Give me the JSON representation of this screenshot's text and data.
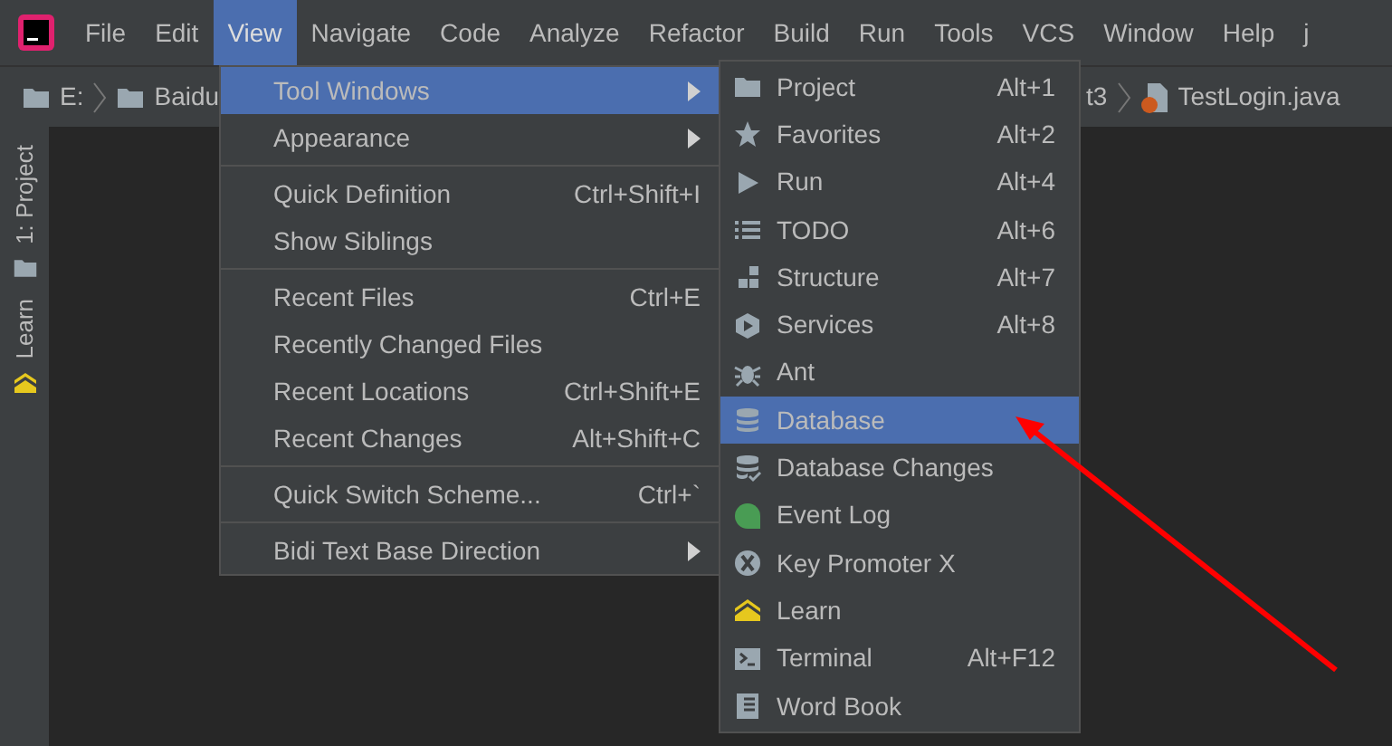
{
  "menu_bar": [
    {
      "label": "File",
      "selected": false
    },
    {
      "label": "Edit",
      "selected": false
    },
    {
      "label": "View",
      "selected": true
    },
    {
      "label": "Navigate",
      "selected": false
    },
    {
      "label": "Code",
      "selected": false
    },
    {
      "label": "Analyze",
      "selected": false
    },
    {
      "label": "Refactor",
      "selected": false
    },
    {
      "label": "Build",
      "selected": false
    },
    {
      "label": "Run",
      "selected": false
    },
    {
      "label": "Tools",
      "selected": false
    },
    {
      "label": "VCS",
      "selected": false
    },
    {
      "label": "Window",
      "selected": false
    },
    {
      "label": "Help",
      "selected": false
    },
    {
      "label": "j",
      "selected": false
    }
  ],
  "breadcrumbs": [
    {
      "label": "E:"
    },
    {
      "label": "Baidu"
    },
    {
      "label": "t3"
    },
    {
      "label": "TestLogin.java"
    }
  ],
  "tool_strip": [
    {
      "label": "1: Project"
    },
    {
      "label": "Learn"
    }
  ],
  "view_menu": [
    {
      "kind": "item",
      "label": "Tool Windows",
      "submenu": true,
      "selected": true
    },
    {
      "kind": "item",
      "label": "Appearance",
      "submenu": true,
      "selected": false
    },
    {
      "kind": "separator"
    },
    {
      "kind": "item",
      "label": "Quick Definition",
      "shortcut": "Ctrl+Shift+I",
      "submenu": false,
      "selected": false
    },
    {
      "kind": "item",
      "label": "Show Siblings",
      "submenu": false,
      "selected": false
    },
    {
      "kind": "separator"
    },
    {
      "kind": "item",
      "label": "Recent Files",
      "shortcut": "Ctrl+E",
      "submenu": false,
      "selected": false
    },
    {
      "kind": "item",
      "label": "Recently Changed Files",
      "submenu": false,
      "selected": false
    },
    {
      "kind": "item",
      "label": "Recent Locations",
      "shortcut": "Ctrl+Shift+E",
      "submenu": false,
      "selected": false
    },
    {
      "kind": "item",
      "label": "Recent Changes",
      "shortcut": "Alt+Shift+C",
      "submenu": false,
      "selected": false
    },
    {
      "kind": "separator"
    },
    {
      "kind": "item",
      "label": "Quick Switch Scheme...",
      "shortcut": "Ctrl+`",
      "submenu": false,
      "selected": false
    },
    {
      "kind": "separator"
    },
    {
      "kind": "item",
      "label": "Bidi Text Base Direction",
      "submenu": true,
      "selected": false
    }
  ],
  "tool_windows_menu": [
    {
      "label": "Project",
      "shortcut": "Alt+1",
      "selected": false
    },
    {
      "label": "Favorites",
      "shortcut": "Alt+2",
      "selected": false
    },
    {
      "label": "Run",
      "shortcut": "Alt+4",
      "selected": false
    },
    {
      "label": "TODO",
      "shortcut": "Alt+6",
      "selected": false
    },
    {
      "label": "Structure",
      "shortcut": "Alt+7",
      "selected": false
    },
    {
      "label": "Services",
      "shortcut": "Alt+8",
      "selected": false
    },
    {
      "label": "Ant",
      "selected": false
    },
    {
      "label": "Database",
      "selected": true
    },
    {
      "label": "Database Changes",
      "selected": false
    },
    {
      "label": "Event Log",
      "selected": false
    },
    {
      "label": "Key Promoter X",
      "selected": false
    },
    {
      "label": "Learn",
      "selected": false
    },
    {
      "label": "Terminal",
      "shortcut": "Alt+F12",
      "selected": false
    },
    {
      "label": "Word Book",
      "selected": false
    }
  ]
}
